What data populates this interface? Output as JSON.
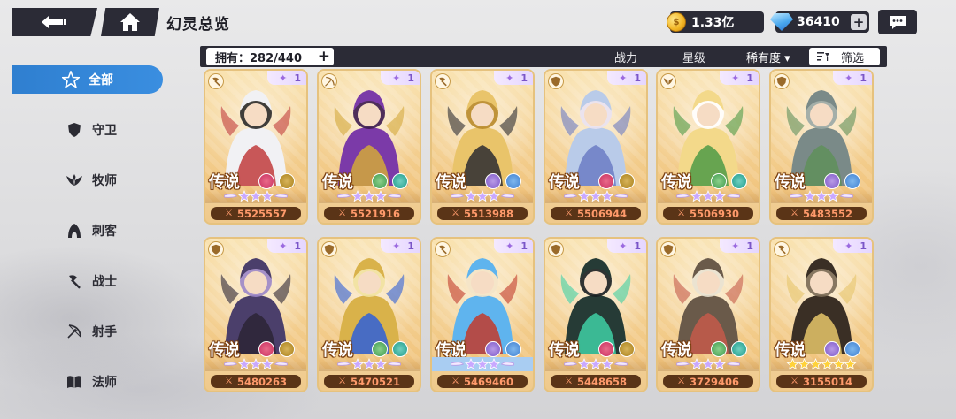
{
  "header": {
    "title": "幻灵总览",
    "gold": "1.33亿",
    "gems": "36410",
    "plus": "+"
  },
  "filter_bar": {
    "owned": "拥有：282/440",
    "owned_plus": "+",
    "sort_power": "战力",
    "sort_star": "星级",
    "sort_rarity": "稀有度 ▾",
    "filter": "筛选"
  },
  "sidebar": {
    "items": [
      {
        "label": "全部",
        "icon": "star-outline-icon"
      },
      {
        "label": "守卫",
        "icon": "shield-icon"
      },
      {
        "label": "牧师",
        "icon": "wings-icon"
      },
      {
        "label": "刺客",
        "icon": "hood-icon"
      },
      {
        "label": "战士",
        "icon": "axe-icon"
      },
      {
        "label": "射手",
        "icon": "bow-icon"
      },
      {
        "label": "法师",
        "icon": "book-icon"
      }
    ]
  },
  "cards": [
    {
      "power": "5525557",
      "level": "1",
      "rarity": "传说",
      "class": "warrior",
      "stars": 3,
      "palette": [
        "#f1f1f4",
        "#c13c3c",
        "#2a2a2a"
      ]
    },
    {
      "power": "5521916",
      "level": "1",
      "rarity": "传说",
      "class": "archer",
      "stars": 3,
      "palette": [
        "#7b3aa8",
        "#d4a93a",
        "#3b1a4e"
      ]
    },
    {
      "power": "5513988",
      "level": "1",
      "rarity": "传说",
      "class": "warrior",
      "stars": 3,
      "palette": [
        "#e9c46a",
        "#2c2c30",
        "#b88a2a"
      ]
    },
    {
      "power": "5506944",
      "level": "1",
      "rarity": "传说",
      "class": "guard",
      "stars": 3,
      "palette": [
        "#b9cbe9",
        "#6b7cc4",
        "#e9e2f2"
      ]
    },
    {
      "power": "5506930",
      "level": "1",
      "rarity": "传说",
      "class": "priest",
      "stars": 3,
      "palette": [
        "#f3d98a",
        "#4d9a45",
        "#ffffff"
      ]
    },
    {
      "power": "5483552",
      "level": "1",
      "rarity": "传说",
      "class": "guard",
      "stars": 3,
      "palette": [
        "#7a8a88",
        "#5f8f5a",
        "#9aa8a5"
      ]
    },
    {
      "power": "5480263",
      "level": "1",
      "rarity": "传说",
      "class": "guard",
      "stars": 3,
      "palette": [
        "#4b3f6b",
        "#2b2535",
        "#9b86c8"
      ]
    },
    {
      "power": "5470521",
      "level": "1",
      "rarity": "传说",
      "class": "guard",
      "stars": 3,
      "palette": [
        "#d9b24a",
        "#2e5fd8",
        "#f1e2a0"
      ]
    },
    {
      "power": "5469460",
      "level": "1",
      "rarity": "传说",
      "class": "warrior",
      "stars": 3,
      "palette": [
        "#5fb4ee",
        "#c23a2b",
        "#f4e4c8"
      ]
    },
    {
      "power": "5448658",
      "level": "1",
      "rarity": "传说",
      "class": "guard",
      "stars": 3,
      "palette": [
        "#263b36",
        "#3fd0a5",
        "#1a1f22"
      ]
    },
    {
      "power": "3729406",
      "level": "1",
      "rarity": "传说",
      "class": "guard",
      "stars": 3,
      "palette": [
        "#6a5a4a",
        "#c45a4a",
        "#e9e2d2"
      ]
    },
    {
      "power": "3155014",
      "level": "1",
      "rarity": "传说",
      "class": "warrior",
      "stars": 6,
      "palette": [
        "#3a2f25",
        "#e6c56a",
        "#7a6a55"
      ]
    }
  ],
  "colors": {
    "accent_blue": "#2f7fd0",
    "dark_panel": "#2b2b36",
    "card_bg": "#efc98b",
    "power_text": "#ff9a6b"
  }
}
